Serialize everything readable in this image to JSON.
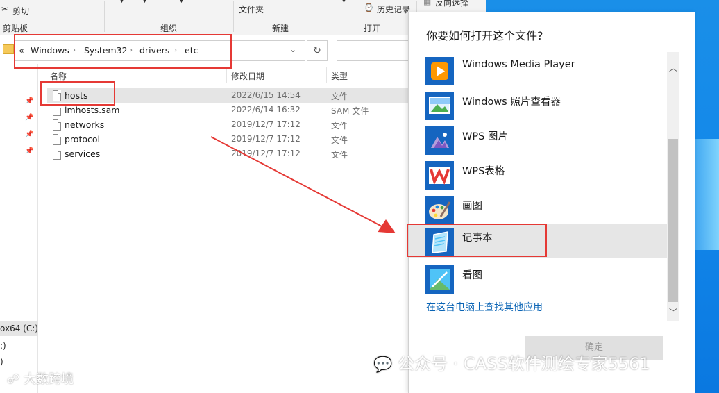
{
  "ribbon": {
    "cut": "剪切",
    "clipboard": "剪贴板",
    "organize": "组织",
    "folder": "文件夹",
    "new": "新建",
    "history": "历史记录",
    "open": "打开",
    "invert_select": "反向选择"
  },
  "address": {
    "overflow": "«",
    "crumbs": [
      "Windows",
      "System32",
      "drivers",
      "etc"
    ]
  },
  "columns": {
    "name": "名称",
    "date": "修改日期",
    "type": "类型"
  },
  "files": [
    {
      "name": "hosts",
      "date": "2022/6/15 14:54",
      "type": "文件"
    },
    {
      "name": "lmhosts.sam",
      "date": "2022/6/14 16:32",
      "type": "SAM 文件"
    },
    {
      "name": "networks",
      "date": "2019/12/7 17:12",
      "type": "文件"
    },
    {
      "name": "protocol",
      "date": "2019/12/7 17:12",
      "type": "文件"
    },
    {
      "name": "services",
      "date": "2019/12/7 17:12",
      "type": "文件"
    }
  ],
  "nav": {
    "drive_c": "ox64 (C:)",
    "drive_2": ":)",
    "drive_3": ")"
  },
  "dialog": {
    "title": "你要如何打开这个文件?",
    "apps": [
      {
        "name": "Windows Media Player",
        "icon": "media-player-icon"
      },
      {
        "name": "Windows 照片查看器",
        "icon": "photo-viewer-icon"
      },
      {
        "name": "WPS 图片",
        "icon": "wps-picture-icon"
      },
      {
        "name": "WPS表格",
        "icon": "wps-spreadsheet-icon"
      },
      {
        "name": "画图",
        "icon": "paint-icon"
      },
      {
        "name": "记事本",
        "icon": "notepad-icon"
      },
      {
        "name": "看图",
        "icon": "image-viewer-icon"
      }
    ],
    "more_link": "在这台电脑上查找其他应用",
    "ok": "确定"
  },
  "watermark": {
    "text": "公众号 · CASS软件测绘专家5561",
    "text2": "大数跨境"
  },
  "colors": {
    "accent_link": "#0a64b5",
    "annotation": "#e53935",
    "desktop": "#1287ea"
  }
}
